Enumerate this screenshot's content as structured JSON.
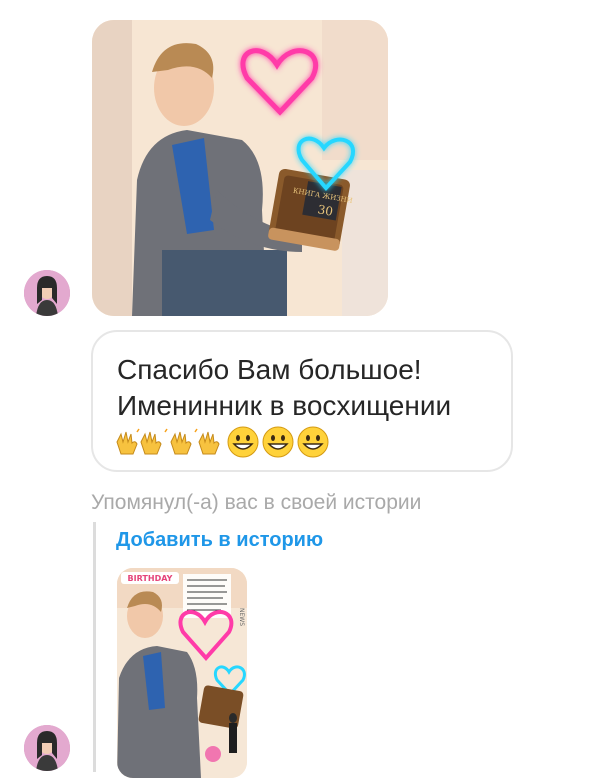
{
  "conversation": {
    "message_text": "Спасибо Вам большое! Именинник в восхищении",
    "emoji": [
      "raising-hands-icon",
      "raising-hands-icon",
      "raising-hands-icon",
      "raising-hands-icon",
      "grinning-face-icon",
      "grinning-face-icon",
      "grinning-face-icon"
    ],
    "story_mention_text": "Упомянул(-а) вас в своей истории",
    "add_to_story_label": "Добавить в историю"
  },
  "photo_message": {
    "book_title": "КНИГА ЖИЗНИ",
    "book_number": "30"
  },
  "story_preview": {
    "sticker_text": "BIRTHDAY",
    "side_label": "NEWS"
  },
  "colors": {
    "link_blue": "#1f97e8",
    "meta_gray": "#a9a9a9",
    "bubble_border": "#e6e6e6",
    "neon_pink": "#ff3ba8",
    "neon_cyan": "#27d7ff"
  }
}
